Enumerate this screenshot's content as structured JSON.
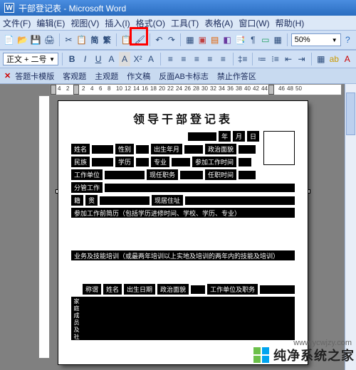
{
  "titlebar": {
    "leftIcon": "W",
    "text": "干部登记表 - Microsoft Word"
  },
  "menu": {
    "items": [
      "文件(F)",
      "编辑(E)",
      "视图(V)",
      "插入(I)",
      "格式(O)",
      "工具(T)",
      "表格(A)",
      "窗口(W)",
      "帮助(H)"
    ],
    "overflow": "▼"
  },
  "toolbar1": {
    "style_label": "正文 + 二号",
    "zoom": "50%"
  },
  "tabs": {
    "items": [
      "答题卡模版",
      "客观题",
      "主观题",
      "作文稿",
      "反面AB卡标志",
      "禁止作答区"
    ]
  },
  "ruler": {
    "leftPre": "4",
    "leftPre2": "2",
    "marks": [
      "2",
      "4",
      "6",
      "8",
      "10",
      "12",
      "14",
      "16",
      "18",
      "20",
      "22",
      "24",
      "26",
      "28",
      "30",
      "32",
      "34",
      "36",
      "38",
      "40",
      "42",
      "44"
    ],
    "rightPost": "46",
    "rightPost2": "48",
    "rightPost3": "50"
  },
  "doc": {
    "title": "领导干部登记表",
    "dateSeg": [
      "年",
      "月",
      "日"
    ],
    "rows": {
      "r1": [
        "姓名",
        "性别",
        "出生年月",
        "政治面貌"
      ],
      "r2": [
        "民族",
        "学历",
        "专业",
        "参加工作时间"
      ],
      "r3": [
        "工作单位",
        "现任职务",
        "任职时间"
      ],
      "r4_label": "分管工作",
      "r5": [
        "籍",
        "贯",
        "现居住址"
      ],
      "para1": "参加工作前简历（包括学历进修时间、学校、学历、专业）",
      "para2": "业务及技能培训（或最两年培训以上实地及培训的两年内的技能及培训）",
      "header": [
        "称谓",
        "姓名",
        "出生日期",
        "政治面貌",
        "工作单位及职务"
      ],
      "sideheads": [
        "家",
        "庭",
        "成",
        "员",
        "及",
        "社"
      ]
    }
  },
  "watermark": {
    "text": "纯净系统之家",
    "url": "www.ycwjzy.com"
  }
}
